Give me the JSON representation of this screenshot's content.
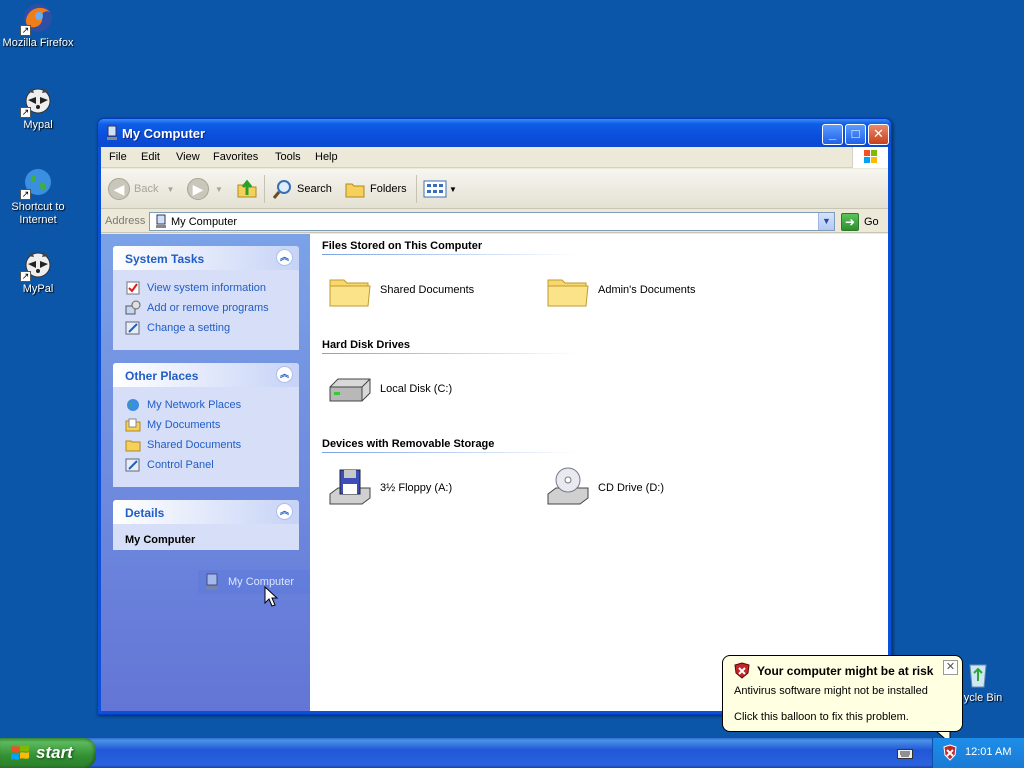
{
  "desktop": {
    "icons": [
      {
        "label": "Mozilla Firefox"
      },
      {
        "label": "Mypal"
      },
      {
        "label": "Shortcut to Internet"
      },
      {
        "label": "MyPal"
      }
    ],
    "recycle_bin_label": "ycle Bin"
  },
  "window": {
    "title": "My Computer",
    "menu": [
      "File",
      "Edit",
      "View",
      "Favorites",
      "Tools",
      "Help"
    ],
    "toolbar": {
      "back": "Back",
      "search": "Search",
      "folders": "Folders"
    },
    "address": {
      "label": "Address",
      "value": "My Computer",
      "go": "Go"
    }
  },
  "taskpane": {
    "system_tasks": {
      "title": "System Tasks",
      "links": [
        "View system information",
        "Add or remove programs",
        "Change a setting"
      ]
    },
    "other_places": {
      "title": "Other Places",
      "links": [
        "My Network Places",
        "My Documents",
        "Shared Documents",
        "Control Panel"
      ]
    },
    "details": {
      "title": "Details",
      "name": "My Computer"
    },
    "drag_ghost_label": "My Computer"
  },
  "content": {
    "groups": [
      {
        "title": "Files Stored on This Computer",
        "items": [
          "Shared Documents",
          "Admin's Documents"
        ]
      },
      {
        "title": "Hard Disk Drives",
        "items": [
          "Local Disk (C:)"
        ]
      },
      {
        "title": "Devices with Removable Storage",
        "items": [
          "3½ Floppy (A:)",
          "CD Drive (D:)"
        ]
      }
    ]
  },
  "taskbar": {
    "start": "start",
    "clock": "12:01 AM"
  },
  "balloon": {
    "title": "Your computer might be at risk",
    "line1": "Antivirus software might not be installed",
    "line2": "Click this balloon to fix this problem."
  },
  "colors": {
    "desktop": "#0b56a8",
    "titlebar": "#0a4fdc",
    "link": "#215dc6",
    "taskbar": "#2157d7",
    "start": "#329032",
    "balloon": "#ffffe1"
  }
}
